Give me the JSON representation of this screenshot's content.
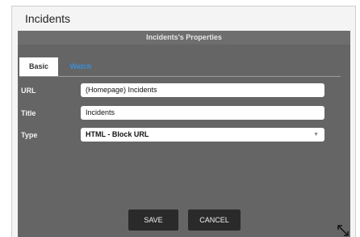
{
  "app_title": "Incidents",
  "dialog": {
    "title": "Incidents's Properties",
    "tabs": [
      {
        "label": "Basic",
        "active": true
      },
      {
        "label": "Watch",
        "active": false
      }
    ],
    "fields": {
      "url": {
        "label": "URL",
        "value": "(Homepage) Incidents"
      },
      "title": {
        "label": "Title",
        "value": "Incidents"
      },
      "type": {
        "label": "Type",
        "value": "HTML - Block URL"
      }
    },
    "buttons": {
      "save": "SAVE",
      "cancel": "CANCEL"
    }
  },
  "colors": {
    "dialog_bg": "#656565",
    "tab_active_bg": "#ffffff",
    "tab_link": "#3a8fd6",
    "button_bg": "#2a2a2a"
  },
  "icons": {
    "corner": "resize-arrows-icon"
  }
}
